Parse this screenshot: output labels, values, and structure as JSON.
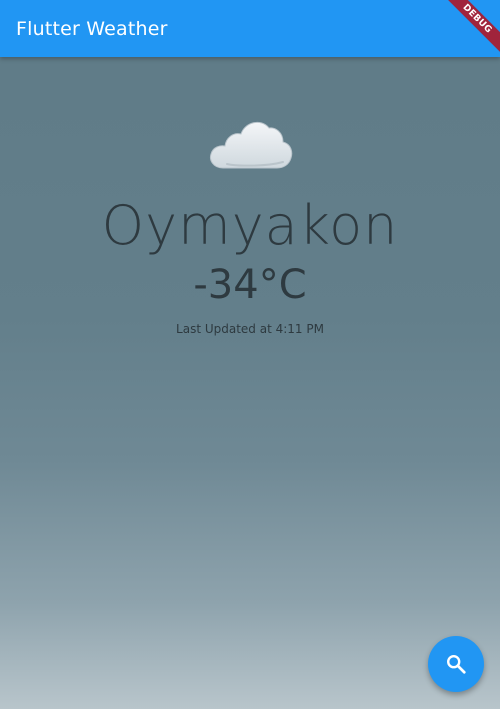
{
  "app_bar": {
    "title": "Flutter Weather",
    "color": "#2196f3"
  },
  "debug_banner": {
    "label": "DEBUG"
  },
  "weather": {
    "icon": "cloud-icon",
    "city": "Oymyakon",
    "temperature": "-34°C",
    "last_updated": "Last Updated at 4:11 PM"
  },
  "fab": {
    "icon": "search-icon"
  }
}
